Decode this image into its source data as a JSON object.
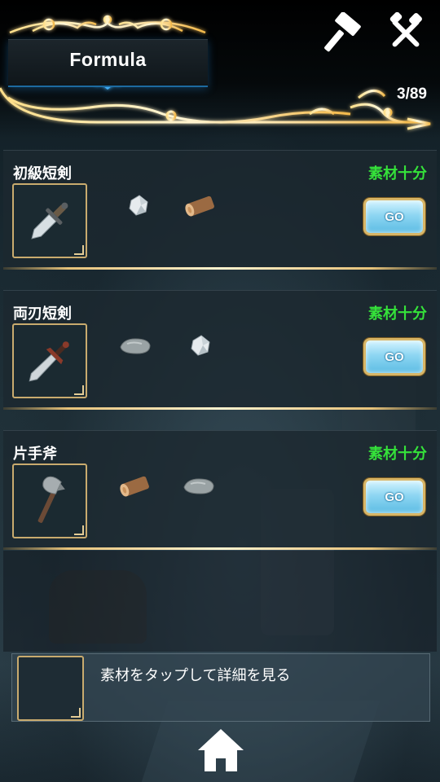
{
  "header": {
    "title": "Formula",
    "counter": "3/89",
    "icons": [
      "hammer-icon",
      "fork-knife-icon"
    ]
  },
  "recipes": [
    {
      "name": "初級短剣",
      "status": "素材十分",
      "item_icon": "dagger-icon",
      "materials": [
        "crystal-ore-icon",
        "wood-log-icon"
      ],
      "go_label": "GO"
    },
    {
      "name": "両刃短剣",
      "status": "素材十分",
      "item_icon": "double-edged-dagger-icon",
      "materials": [
        "stone-icon",
        "crystal-ore-icon"
      ],
      "go_label": "GO"
    },
    {
      "name": "片手斧",
      "status": "素材十分",
      "item_icon": "hand-axe-icon",
      "materials": [
        "wood-log-icon",
        "stone-icon"
      ],
      "go_label": "GO"
    }
  ],
  "detail": {
    "hint": "素材をタップして詳細を見る"
  },
  "colors": {
    "status_green": "#35e23a",
    "gold": "#c9ab6e",
    "go_blue": "#8ed6f2"
  },
  "nav": {
    "home_icon": "home-icon"
  }
}
